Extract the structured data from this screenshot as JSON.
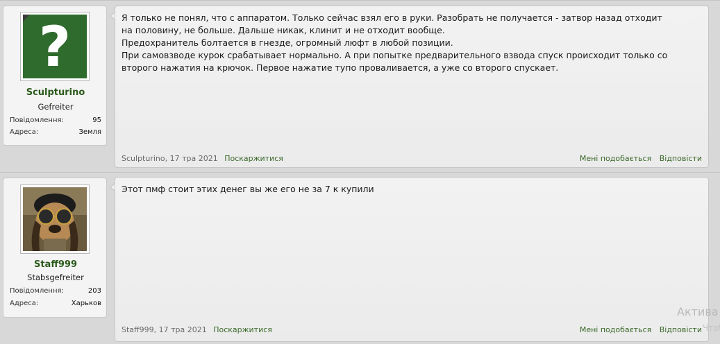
{
  "posts": [
    {
      "user": {
        "name": "Sculpturino",
        "title": "Gefreiter",
        "avatar": "question-mark-avatar",
        "stat1_label": "Повідомлення:",
        "stat1_value": "95",
        "stat2_label": "Адреса:",
        "stat2_value": "Земля"
      },
      "message_lines": [
        "Я только не понял, что с аппаратом. Только сейчас взял его в руки. Разобрать не получается - затвор назад отходит",
        "на половину, не больше. Дальше никак, клинит и не отходит вообще.",
        "Предохранитель болтается в гнезде, огромный люфт в любой позиции.",
        "При самовзводе курок срабатывает нормально. А при попытке предварительного взвода спуск происходит только со",
        "второго нажатия на крючок. Первое нажатие тупо проваливается, а уже со второго спускает."
      ],
      "meta": "Sculpturino, 17 тра 2021",
      "report": "Поскаржитися",
      "like": "Мені подобається",
      "reply": "Відповісти"
    },
    {
      "user": {
        "name": "Staff999",
        "title": "Stabsgefreiter",
        "avatar": "dog-with-sunglasses-avatar",
        "stat1_label": "Повідомлення:",
        "stat1_value": "203",
        "stat2_label": "Адреса:",
        "stat2_value": "Харьков"
      },
      "message_lines": [
        "Этот пмф стоит этих денег вы же его не за 7 к купили"
      ],
      "meta": "Staff999, 17 тра 2021",
      "report": "Поскаржитися",
      "like": "Мені подобається",
      "reply": "Відповісти"
    }
  ],
  "watermark": {
    "line1": "Актива",
    "line2": "Чтобы ак"
  },
  "colors": {
    "accent": "#3b6a2a",
    "username": "#2a5a1a",
    "background": "#d8d8d8"
  }
}
